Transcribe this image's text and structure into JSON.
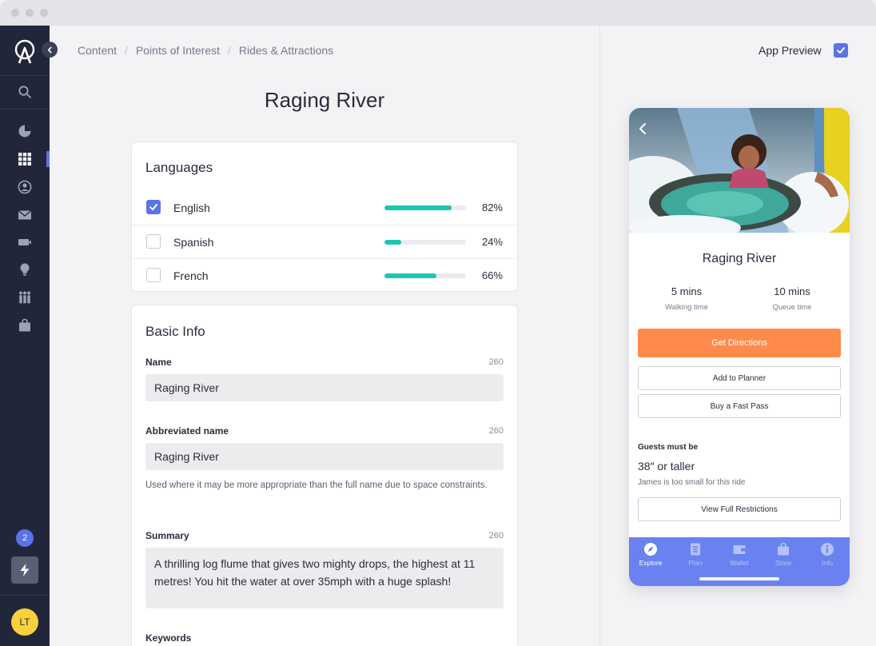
{
  "sidebar": {
    "notification_count": "2",
    "user_initials": "LT"
  },
  "breadcrumb": [
    "Content",
    "Points of Interest",
    "Rides & Attractions"
  ],
  "page_title": "Raging River",
  "languages": {
    "title": "Languages",
    "items": [
      {
        "name": "English",
        "checked": true,
        "progress_percent": 82,
        "label": "82%"
      },
      {
        "name": "Spanish",
        "checked": false,
        "progress_percent": 24,
        "label": "24%"
      },
      {
        "name": "French",
        "checked": false,
        "progress_percent": 66,
        "label": "66%"
      }
    ]
  },
  "basic_info": {
    "title": "Basic Info",
    "name": {
      "label": "Name",
      "count": "260",
      "value": "Raging River"
    },
    "abbreviated": {
      "label": "Abbreviated name",
      "count": "260",
      "value": "Raging River",
      "help": "Used where it may be more appropriate than the full name due to space constraints."
    },
    "summary": {
      "label": "Summary",
      "count": "260",
      "value": "A thrilling log flume that gives two mighty drops, the highest at 11 metres! You hit the water at over 35mph with a huge splash!"
    },
    "keywords": {
      "label": "Keywords"
    }
  },
  "preview": {
    "label": "App Preview",
    "enabled": true,
    "phone": {
      "title": "Raging River",
      "walking": {
        "value": "5 mins",
        "label": "Walking time"
      },
      "queue": {
        "value": "10 mins",
        "label": "Queue time"
      },
      "directions_label": "Get Directions",
      "planner_label": "Add to Planner",
      "fastpass_label": "Buy a Fast Pass",
      "guests_label": "Guests must be",
      "height": "38″ or taller",
      "note": "James is too small for this ride",
      "restrictions_label": "View Full Restrictions",
      "tabs": [
        {
          "label": "Explore",
          "icon": "compass-icon",
          "active": true
        },
        {
          "label": "Plan",
          "icon": "clipboard-icon",
          "active": false
        },
        {
          "label": "Wallet",
          "icon": "wallet-icon",
          "active": false
        },
        {
          "label": "Store",
          "icon": "bag-icon",
          "active": false
        },
        {
          "label": "Info",
          "icon": "info-icon",
          "active": false
        }
      ]
    }
  },
  "colors": {
    "accent": "#5b73e8",
    "progress": "#1ec4b4",
    "primary_button": "#ff8a4c",
    "sidebar": "#22263a",
    "tabbar": "#6a82f0"
  }
}
